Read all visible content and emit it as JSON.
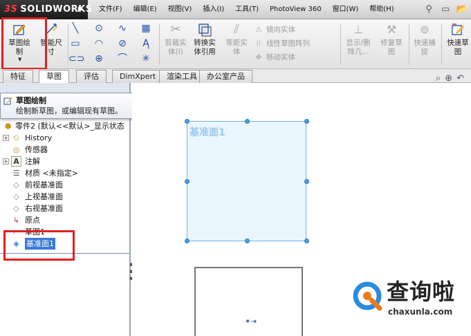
{
  "app": {
    "logo_ds": "3S",
    "logo_name": "SOLIDWORKS",
    "menu": [
      "文件(F)",
      "编辑(E)",
      "视图(V)",
      "插入(I)",
      "工具(T)",
      "PhotoView 360",
      "窗口(W)",
      "帮助(H)"
    ]
  },
  "toolbar": {
    "sketch": "草图绘\n制",
    "smart_dim": "智能尺\n寸",
    "trim": "剪裁实\n体(I)",
    "convert": "转换实\n体引用",
    "offset": "等距实\n体",
    "mirror": "镜向实体",
    "linear_pattern": "线性草图阵列",
    "move": "移动实体",
    "show_delete": "显示/删\n除几...",
    "repair": "修复草\n图",
    "quick_snap": "快速捕\n捉",
    "quick_sketch": "快速草\n图"
  },
  "tabs": [
    "特征",
    "草图",
    "评估",
    "DimXpert",
    "渲染工具",
    "办公室产品"
  ],
  "tooltip": {
    "title": "草图绘制",
    "desc": "绘制新草图，或编辑现有草图。"
  },
  "tree": {
    "root": "零件2 (默认<<默认>_显示状态",
    "items": [
      {
        "label": "History",
        "icon": "history-icon",
        "expand": "+"
      },
      {
        "label": "传感器",
        "icon": "sensor-icon",
        "expand": ""
      },
      {
        "label": "注解",
        "icon": "annotation-icon",
        "expand": "+"
      },
      {
        "label": "材质 <未指定>",
        "icon": "material-icon",
        "expand": ""
      },
      {
        "label": "前视基准面",
        "icon": "plane-icon",
        "expand": ""
      },
      {
        "label": "上视基准面",
        "icon": "plane-icon",
        "expand": ""
      },
      {
        "label": "右视基准面",
        "icon": "plane-icon",
        "expand": ""
      },
      {
        "label": "原点",
        "icon": "origin-icon",
        "expand": ""
      },
      {
        "label": "草图1",
        "icon": "sketch-icon",
        "expand": ""
      },
      {
        "label": "基准面1",
        "icon": "plane-icon",
        "expand": ""
      }
    ]
  },
  "graphics": {
    "plane_label": "基准面1"
  },
  "watermark": {
    "text": "查询啦",
    "url": "chaxunla.com"
  },
  "colors": {
    "highlight": "#e02020",
    "plane_fill": "#eaf6fd",
    "plane_border": "#6fb4e8",
    "selection": "#3a78d8"
  }
}
